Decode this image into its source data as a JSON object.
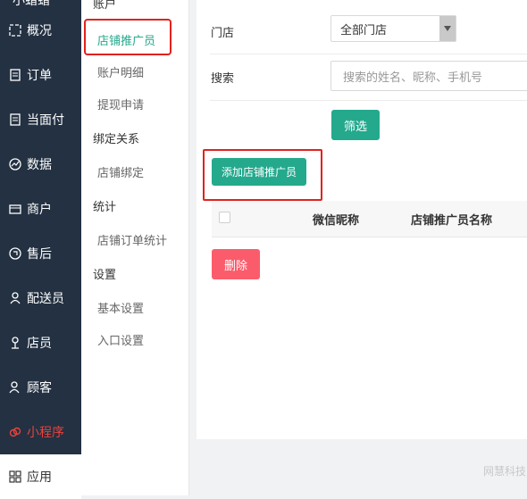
{
  "nav": {
    "top_partial": "小蜡蜡",
    "items": [
      {
        "label": "概况",
        "icon": "overview-icon"
      },
      {
        "label": "订单",
        "icon": "order-icon"
      },
      {
        "label": "当面付",
        "icon": "pay-icon"
      },
      {
        "label": "数据",
        "icon": "chart-icon"
      },
      {
        "label": "商户",
        "icon": "store-icon"
      },
      {
        "label": "售后",
        "icon": "aftersale-icon"
      },
      {
        "label": "配送员",
        "icon": "person-icon"
      },
      {
        "label": "店员",
        "icon": "clerk-icon"
      },
      {
        "label": "顾客",
        "icon": "customer-icon"
      },
      {
        "label": "小程序",
        "icon": "miniprogram-icon"
      },
      {
        "label": "应用",
        "icon": "apps-icon"
      }
    ],
    "colors": {
      "bg": "#233142",
      "highlight": "#e8433d"
    }
  },
  "submenu": {
    "group_account": "账户",
    "items_account": [
      "店铺推广员",
      "账户明细",
      "提现申请"
    ],
    "group_bind": "绑定关系",
    "items_bind": [
      "店铺绑定"
    ],
    "group_stats": "统计",
    "items_stats": [
      "店铺订单统计"
    ],
    "group_settings": "设置",
    "items_settings": [
      "基本设置",
      "入口设置"
    ]
  },
  "filters": {
    "store_label": "门店",
    "store_value": "全部门店",
    "search_label": "搜索",
    "search_placeholder": "搜索的姓名、昵称、手机号",
    "filter_button": "筛选"
  },
  "actions": {
    "add_button": "添加店铺推广员",
    "delete_button": "删除"
  },
  "table": {
    "columns": [
      "微信昵称",
      "店铺推广员名称"
    ]
  },
  "footer": {
    "watermark": "网慧科技"
  },
  "accent": "#24a98d"
}
